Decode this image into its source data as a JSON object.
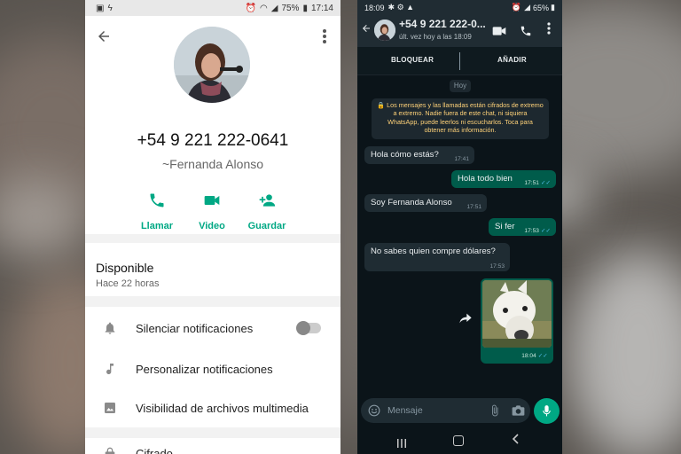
{
  "left_phone": {
    "status_bar": {
      "battery": "75%",
      "time": "17:14"
    },
    "contact": {
      "phone": "+54 9 221 222-0641",
      "alias": "~Fernanda Alonso"
    },
    "actions": [
      {
        "label": "Llamar",
        "icon": "phone-icon"
      },
      {
        "label": "Video",
        "icon": "video-camera-icon"
      },
      {
        "label": "Guardar",
        "icon": "add-person-icon"
      }
    ],
    "about": {
      "title": "Disponible",
      "subtitle": "Hace 22 horas"
    },
    "settings": [
      {
        "label": "Silenciar notificaciones",
        "icon": "bell-icon",
        "toggle": false
      },
      {
        "label": "Personalizar notificaciones",
        "icon": "music-note-icon"
      },
      {
        "label": "Visibilidad de archivos multimedia",
        "icon": "image-icon"
      }
    ],
    "cipher_label": "Cifrado"
  },
  "right_phone": {
    "status_bar": {
      "time": "18:09",
      "battery": "65%"
    },
    "header": {
      "name": "+54 9 221 222-0...",
      "last_seen": "últ. vez hoy a las 18:09"
    },
    "bar_buttons": {
      "block": "BLOQUEAR",
      "add": "AÑADIR"
    },
    "day_chip": "Hoy",
    "encryption_notice": "🔒 Los mensajes y las llamadas están cifrados de extremo a extremo. Nadie fuera de este chat, ni siquiera WhatsApp, puede leerlos ni escucharlos. Toca para obtener más información.",
    "messages": [
      {
        "dir": "in",
        "text": "Hola cómo estás?",
        "time": "17:41"
      },
      {
        "dir": "out",
        "text": "Hola todo bien",
        "time": "17:51"
      },
      {
        "dir": "in",
        "text": "Soy Fernanda Alonso",
        "time": "17:51"
      },
      {
        "dir": "out",
        "text": "Si fer",
        "time": "17:53"
      },
      {
        "dir": "in",
        "text": "No sabes quien compre dólares?",
        "time": "17:53"
      }
    ],
    "image_message": {
      "time": "18:04"
    },
    "input_placeholder": "Mensaje",
    "colors": {
      "accent": "#00a884",
      "outgoing_bubble": "#005c4b",
      "incoming_bubble": "#1f2c33",
      "read_ticks": "#53bdeb"
    }
  }
}
